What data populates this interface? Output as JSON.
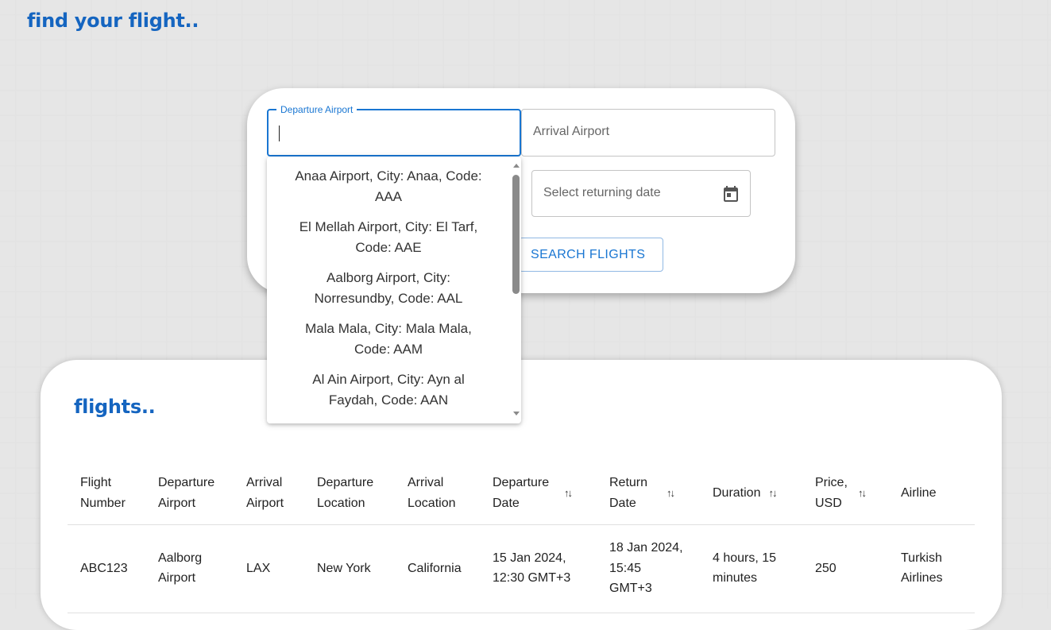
{
  "header": {
    "title": "find your flight.."
  },
  "search": {
    "departure_label": "Departure Airport",
    "departure_value": "",
    "arrival_placeholder": "Arrival Airport",
    "return_date_placeholder": "Select returning date",
    "search_button": "SEARCH FLIGHTS",
    "dropdown_options": [
      "Anaa Airport,  City: Anaa,  Code: AAA",
      "El Mellah Airport,  City: El Tarf,  Code: AAE",
      "Aalborg Airport,  City: Norresundby,  Code: AAL",
      "Mala Mala,  City: Mala Mala,  Code: AAM",
      "Al Ain Airport,  City: Ayn al Faydah,  Code: AAN"
    ]
  },
  "results": {
    "title": "flights..",
    "columns": [
      {
        "label": "Flight Number",
        "sortable": false
      },
      {
        "label": "Departure Airport",
        "sortable": false
      },
      {
        "label": "Arrival Airport",
        "sortable": false
      },
      {
        "label": "Departure Location",
        "sortable": false
      },
      {
        "label": "Arrival Location",
        "sortable": false
      },
      {
        "label": "Departure Date",
        "sortable": true
      },
      {
        "label": "Return Date",
        "sortable": true
      },
      {
        "label": "Duration",
        "sortable": true
      },
      {
        "label": "Price, USD",
        "sortable": true
      },
      {
        "label": "Airline",
        "sortable": false
      }
    ],
    "rows": [
      [
        "ABC123",
        "Aalborg Airport",
        "LAX",
        "New York",
        "California",
        "15 Jan 2024, 12:30 GMT+3",
        "18 Jan 2024, 15:45 GMT+3",
        "4 hours, 15 minutes",
        "250",
        "Turkish Airlines"
      ]
    ]
  },
  "icons": {
    "calendar": "calendar-icon",
    "sort": "sort-arrows-icon"
  },
  "colors": {
    "accent": "#1976d2",
    "title": "#1565c0"
  }
}
